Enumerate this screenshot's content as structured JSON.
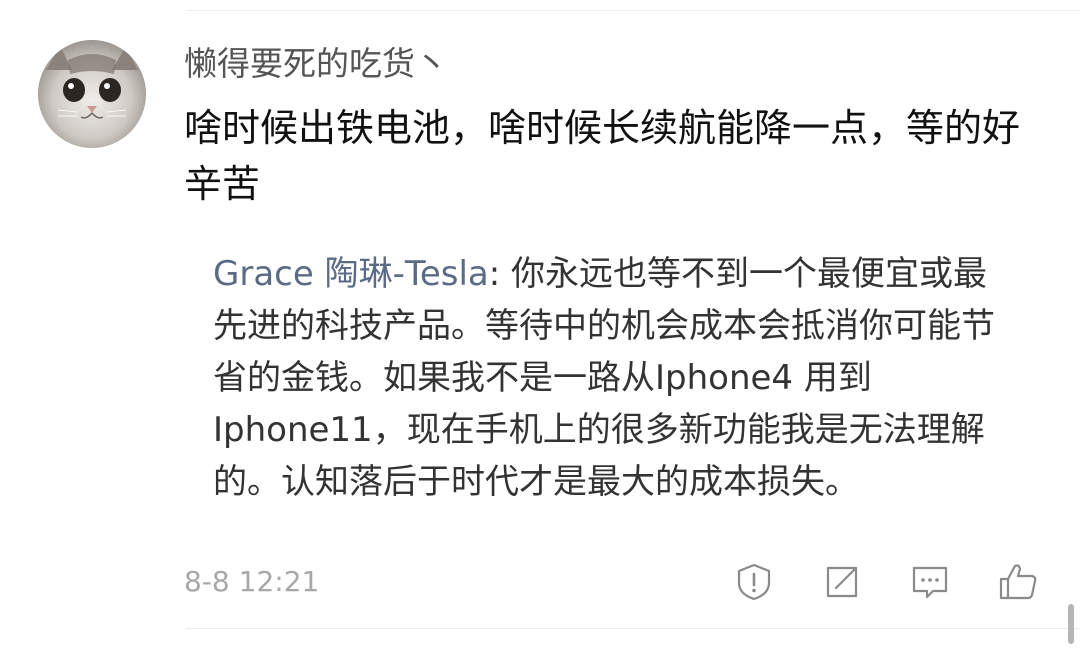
{
  "comment": {
    "username": "懒得要死的吃货丶",
    "text": "啥时候出铁电池，啥时候长续航能降一点，等的好辛苦"
  },
  "reply": {
    "author": "Grace 陶琳-Tesla",
    "separator": ":",
    "text": "你永远也等不到一个最便宜或最先进的科技产品。等待中的机会成本会抵消你可能节省的金钱。如果我不是一路从Iphone4 用到Iphone11，现在手机上的很多新功能我是无法理解的。认知落后于时代才是最大的成本损失。"
  },
  "meta": {
    "timestamp": "8-8 12:21"
  },
  "actions": [
    {
      "icon": "report-icon"
    },
    {
      "icon": "share-icon"
    },
    {
      "icon": "reply-comment-icon"
    },
    {
      "icon": "like-icon"
    }
  ],
  "colors": {
    "username": "#555555",
    "reply_author": "#5b6b86",
    "timestamp": "#a8a8a8",
    "icon": "#8a8a8a"
  }
}
